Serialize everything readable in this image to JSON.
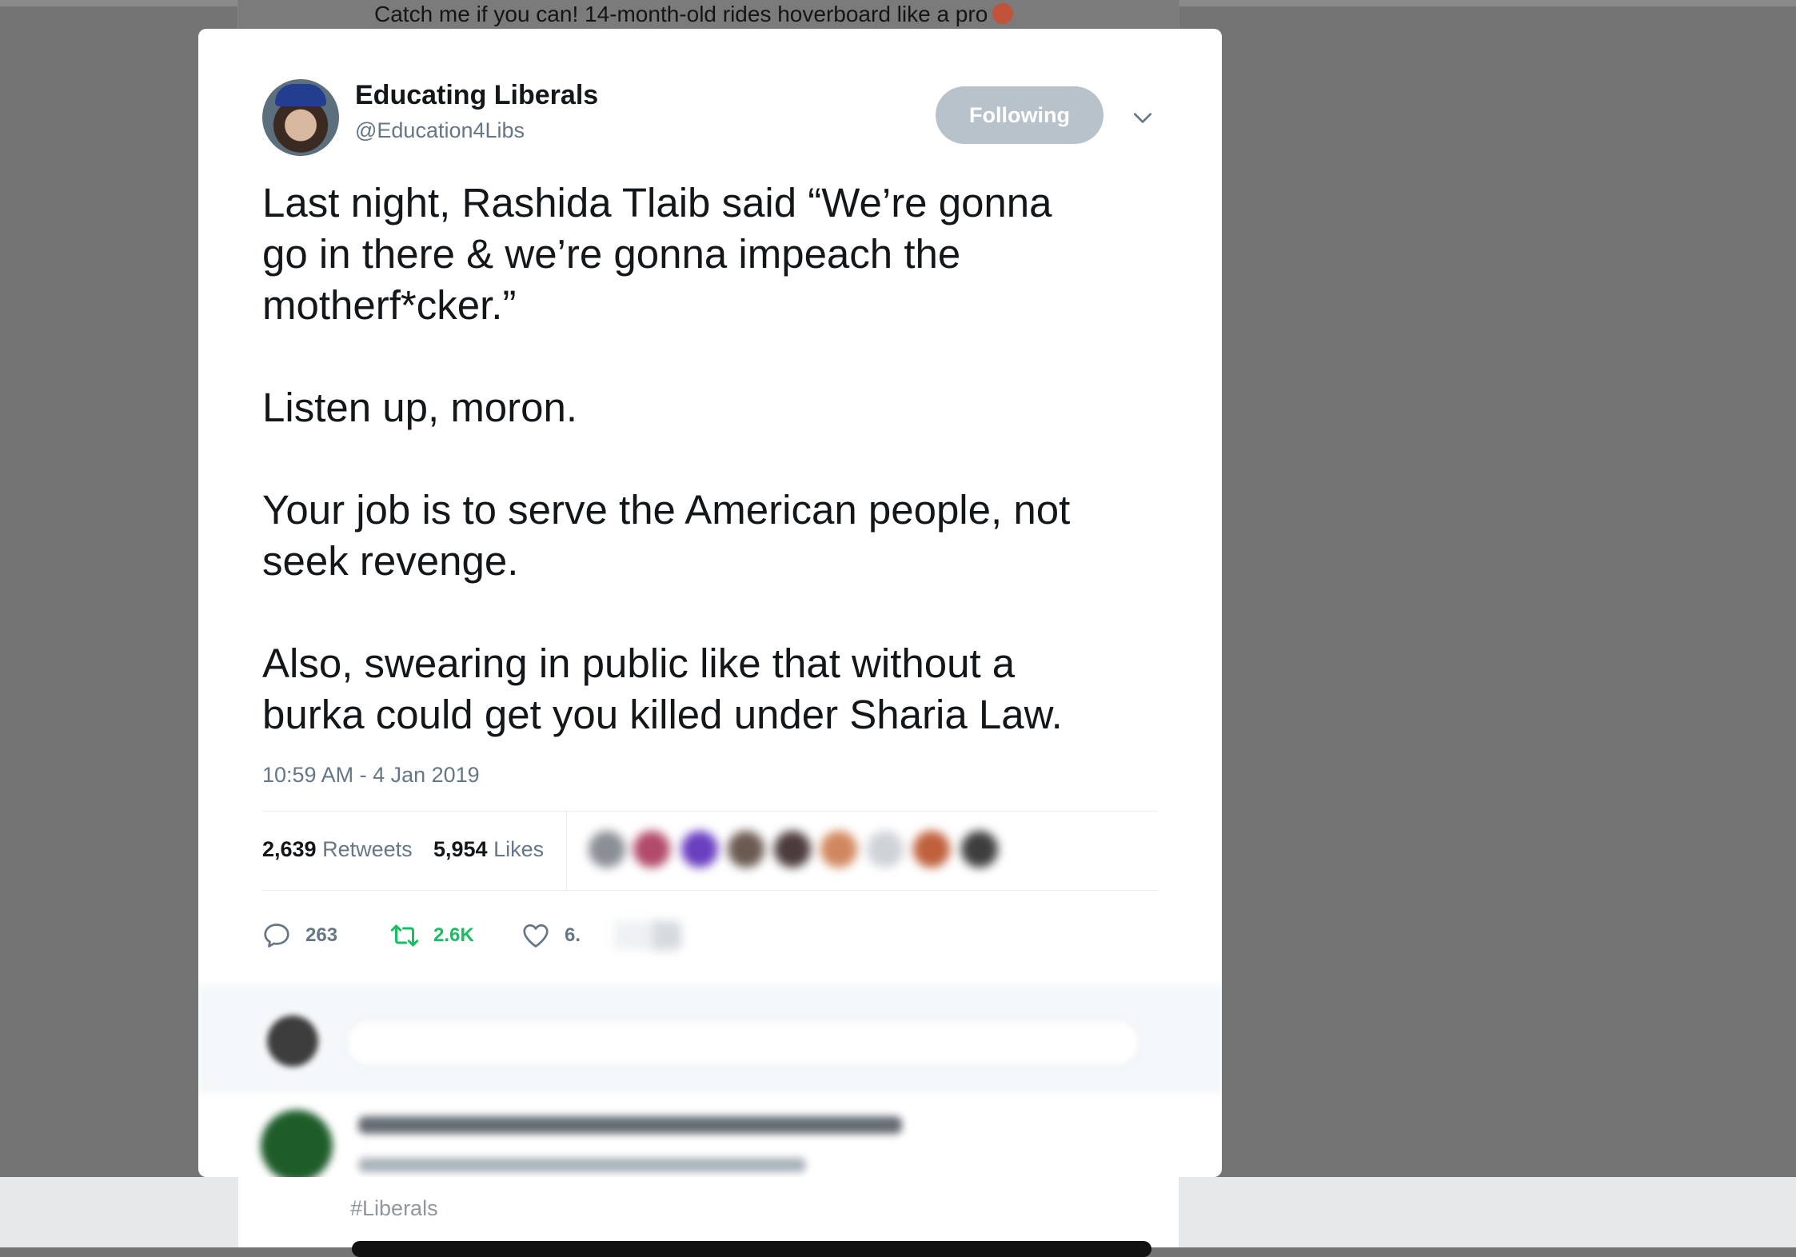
{
  "background": {
    "headline": "Catch me if you can! 14-month-old rides hoverboard like a pro",
    "hashtag": "#Liberals"
  },
  "tweet": {
    "display_name": "Educating Liberals",
    "handle": "@Education4Libs",
    "follow_button": "Following",
    "text": [
      "Last night, Rashida Tlaib said “We’re gonna",
      "go in there & we’re gonna impeach the",
      "motherf*cker.”",
      "Listen up, moron.",
      "Your job is to serve the American people, not",
      "seek revenge.",
      "Also, swearing in public like that without a",
      "burka could get you killed under Sharia Law."
    ],
    "timestamp": "10:59 AM - 4 Jan 2019",
    "retweets_count": "2,639",
    "retweets_label": "Retweets",
    "likes_count": "5,954",
    "likes_label": "Likes",
    "actions": {
      "reply_count": "263",
      "retweet_count": "2.6K",
      "like_count": "6."
    }
  },
  "colors": {
    "retweet_green": "#17bf63",
    "muted": "#657786",
    "follow_button_bg": "#b8c2cb"
  },
  "icons": [
    "chevron-down-icon",
    "reply-icon",
    "retweet-icon",
    "heart-icon"
  ]
}
